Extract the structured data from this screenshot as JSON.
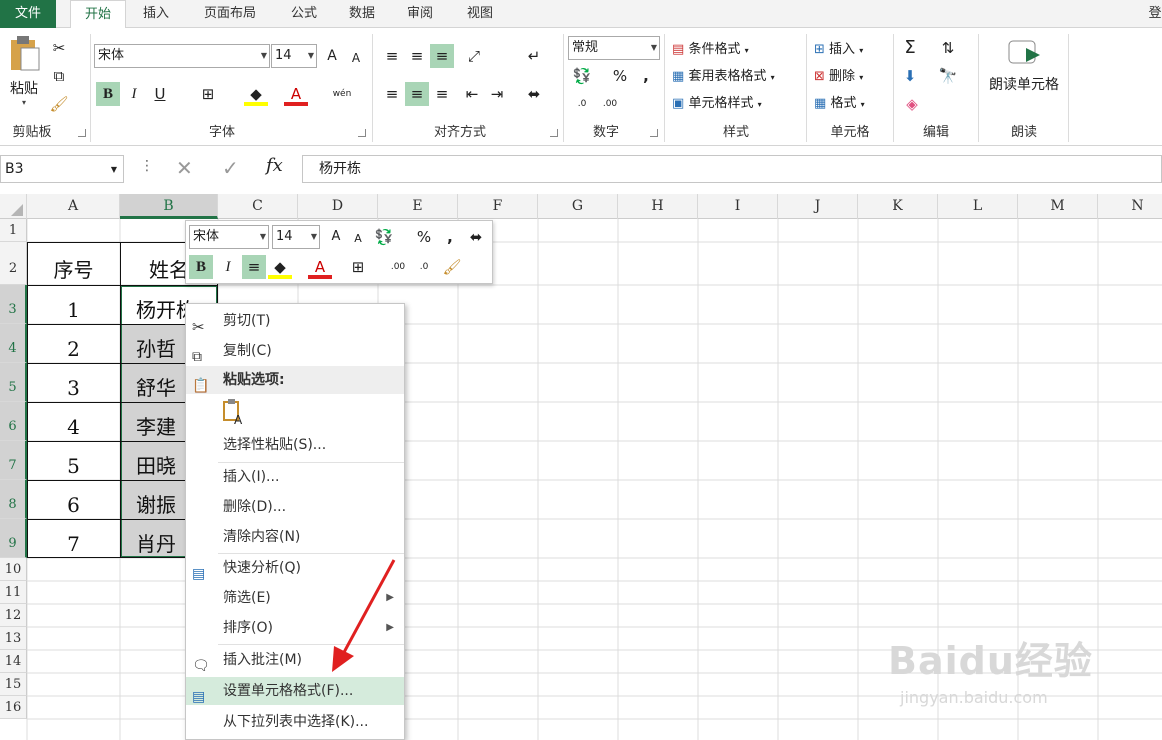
{
  "tabs": [
    "文件",
    "开始",
    "插入",
    "页面布局",
    "公式",
    "数据",
    "审阅",
    "视图"
  ],
  "ribbon": {
    "clipboard": {
      "paste": "粘贴",
      "group": "剪贴板"
    },
    "font": {
      "name": "宋体",
      "size": "14",
      "bold": "B",
      "italic": "I",
      "underline": "U",
      "grow": "A",
      "shrink": "A",
      "wen": "wén",
      "group": "字体"
    },
    "align": {
      "group": "对齐方式"
    },
    "number": {
      "format": "常规",
      "percent": "%",
      "comma": ",",
      "inc": ".0",
      "dec": ".00",
      "group": "数字"
    },
    "styles": {
      "cond": "条件格式",
      "table": "套用表格格式",
      "cell": "单元格样式",
      "group": "样式"
    },
    "cells": {
      "insert": "插入",
      "delete": "删除",
      "format": "格式",
      "group": "单元格"
    },
    "edit": {
      "sigma": "Σ",
      "group": "编辑"
    },
    "read": {
      "label": "朗读单元格",
      "group": "朗读"
    },
    "corner": "登"
  },
  "formula": {
    "namebox": "B3",
    "fx": "fx",
    "value": "杨开栋"
  },
  "columns": [
    "A",
    "B",
    "C",
    "D",
    "E",
    "F",
    "G",
    "H",
    "I",
    "J",
    "K",
    "L",
    "M",
    "N"
  ],
  "rows": [
    "1",
    "2",
    "3",
    "4",
    "5",
    "6",
    "7",
    "8",
    "9",
    "10",
    "11",
    "12",
    "13",
    "14",
    "15",
    "16"
  ],
  "table": {
    "headers": [
      "序号",
      "姓名"
    ],
    "data": [
      [
        "1",
        "杨开栋"
      ],
      [
        "2",
        "孙哲"
      ],
      [
        "3",
        "舒华"
      ],
      [
        "4",
        "李建"
      ],
      [
        "5",
        "田晓"
      ],
      [
        "6",
        "谢振"
      ],
      [
        "7",
        "肖丹"
      ]
    ]
  },
  "mini_toolbar": {
    "font": "宋体",
    "size": "14",
    "bold": "B",
    "italic": "I",
    "percent": "%",
    "comma": ","
  },
  "context_menu": {
    "items": [
      {
        "label": "剪切(T)",
        "icon": "scissors-icon"
      },
      {
        "label": "复制(C)",
        "icon": "copy-icon"
      },
      {
        "label": "粘贴选项:",
        "icon": "paste-icon"
      },
      {
        "label": "选择性粘贴(S)...",
        "icon": ""
      },
      {
        "label": "插入(I)...",
        "icon": ""
      },
      {
        "label": "删除(D)...",
        "icon": ""
      },
      {
        "label": "清除内容(N)",
        "icon": ""
      },
      {
        "label": "快速分析(Q)",
        "icon": "quick-analysis-icon"
      },
      {
        "label": "筛选(E)",
        "icon": ""
      },
      {
        "label": "排序(O)",
        "icon": ""
      },
      {
        "label": "插入批注(M)",
        "icon": "comment-icon"
      },
      {
        "label": "设置单元格格式(F)...",
        "icon": "format-cells-icon"
      },
      {
        "label": "从下拉列表中选择(K)...",
        "icon": ""
      }
    ]
  },
  "watermark": {
    "brand": "Baidu经验",
    "url": "jingyan.baidu.com"
  },
  "colors": {
    "accent": "#217346",
    "hover": "#d5ebdc",
    "arrow": "#e02020"
  }
}
